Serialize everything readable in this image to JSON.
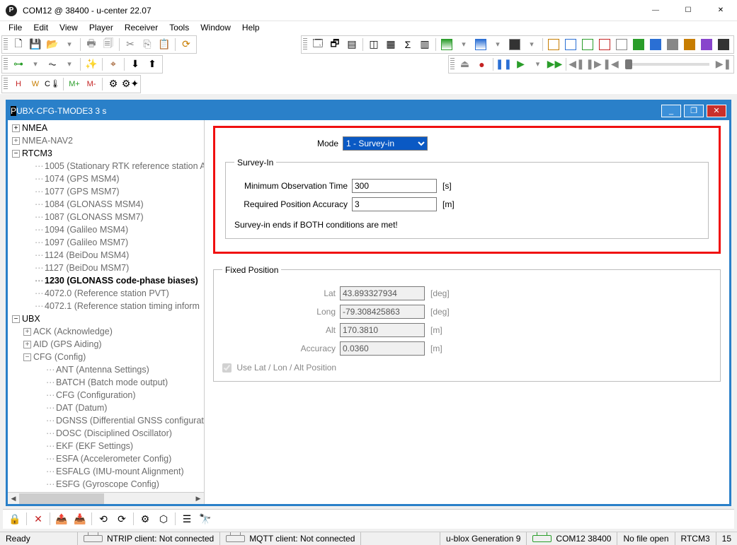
{
  "window": {
    "title": "COM12 @ 38400 - u-center 22.07",
    "min": "—",
    "max": "☐",
    "close": "✕"
  },
  "menu": [
    "File",
    "Edit",
    "View",
    "Player",
    "Receiver",
    "Tools",
    "Window",
    "Help"
  ],
  "innerwin": {
    "title": "UBX-CFG-TMODE3 3 s",
    "min": "_",
    "max": "❐",
    "close": "✕"
  },
  "tree": {
    "nmea": "NMEA",
    "nmea_nav2": "NMEA-NAV2",
    "rtcm3": "RTCM3",
    "rtcm_children": [
      "1005 (Stationary RTK reference station A",
      "1074 (GPS MSM4)",
      "1077 (GPS MSM7)",
      "1084 (GLONASS MSM4)",
      "1087 (GLONASS MSM7)",
      "1094 (Galileo MSM4)",
      "1097 (Galileo MSM7)",
      "1124 (BeiDou MSM4)",
      "1127 (BeiDou MSM7)"
    ],
    "rtcm_sel": "1230 (GLONASS code-phase biases)",
    "rtcm_after": [
      "4072.0 (Reference station PVT)",
      "4072.1 (Reference station timing inform"
    ],
    "ubx": "UBX",
    "ack": "ACK (Acknowledge)",
    "aid": "AID (GPS Aiding)",
    "cfg": "CFG (Config)",
    "cfg_children": [
      "ANT (Antenna Settings)",
      "BATCH (Batch mode output)",
      "CFG (Configuration)",
      "DAT (Datum)",
      "DGNSS (Differential GNSS configurat",
      "DOSC (Disciplined Oscillator)",
      "EKF (EKF Settings)",
      "ESFA (Accelerometer Config)",
      "ESFALG (IMU-mount Alignment)",
      "ESFG (Gyroscope Config)"
    ]
  },
  "form": {
    "mode_label": "Mode",
    "mode_value": "1 - Survey-in",
    "survey_legend": "Survey-In",
    "min_obs_label": "Minimum Observation Time",
    "min_obs_value": "300",
    "sec_unit": "[s]",
    "acc_label": "Required Position Accuracy",
    "acc_value": "3",
    "m_unit": "[m]",
    "note": "Survey-in ends if BOTH conditions are met!",
    "fixed_legend": "Fixed Position",
    "lat_label": "Lat",
    "lat_value": "43.893327934",
    "deg_unit": "[deg]",
    "long_label": "Long",
    "long_value": "-79.308425863",
    "alt_label": "Alt",
    "alt_value": "170.3810",
    "facc_label": "Accuracy",
    "facc_value": "0.0360",
    "chk_label": "Use Lat / Lon / Alt Position"
  },
  "status": {
    "ready": "Ready",
    "ntrip": "NTRIP client: Not connected",
    "mqtt": "MQTT client: Not connected",
    "gen": "u-blox Generation 9",
    "com": "COM12 38400",
    "file": "No file open",
    "proto": "RTCM3",
    "num": "15"
  }
}
